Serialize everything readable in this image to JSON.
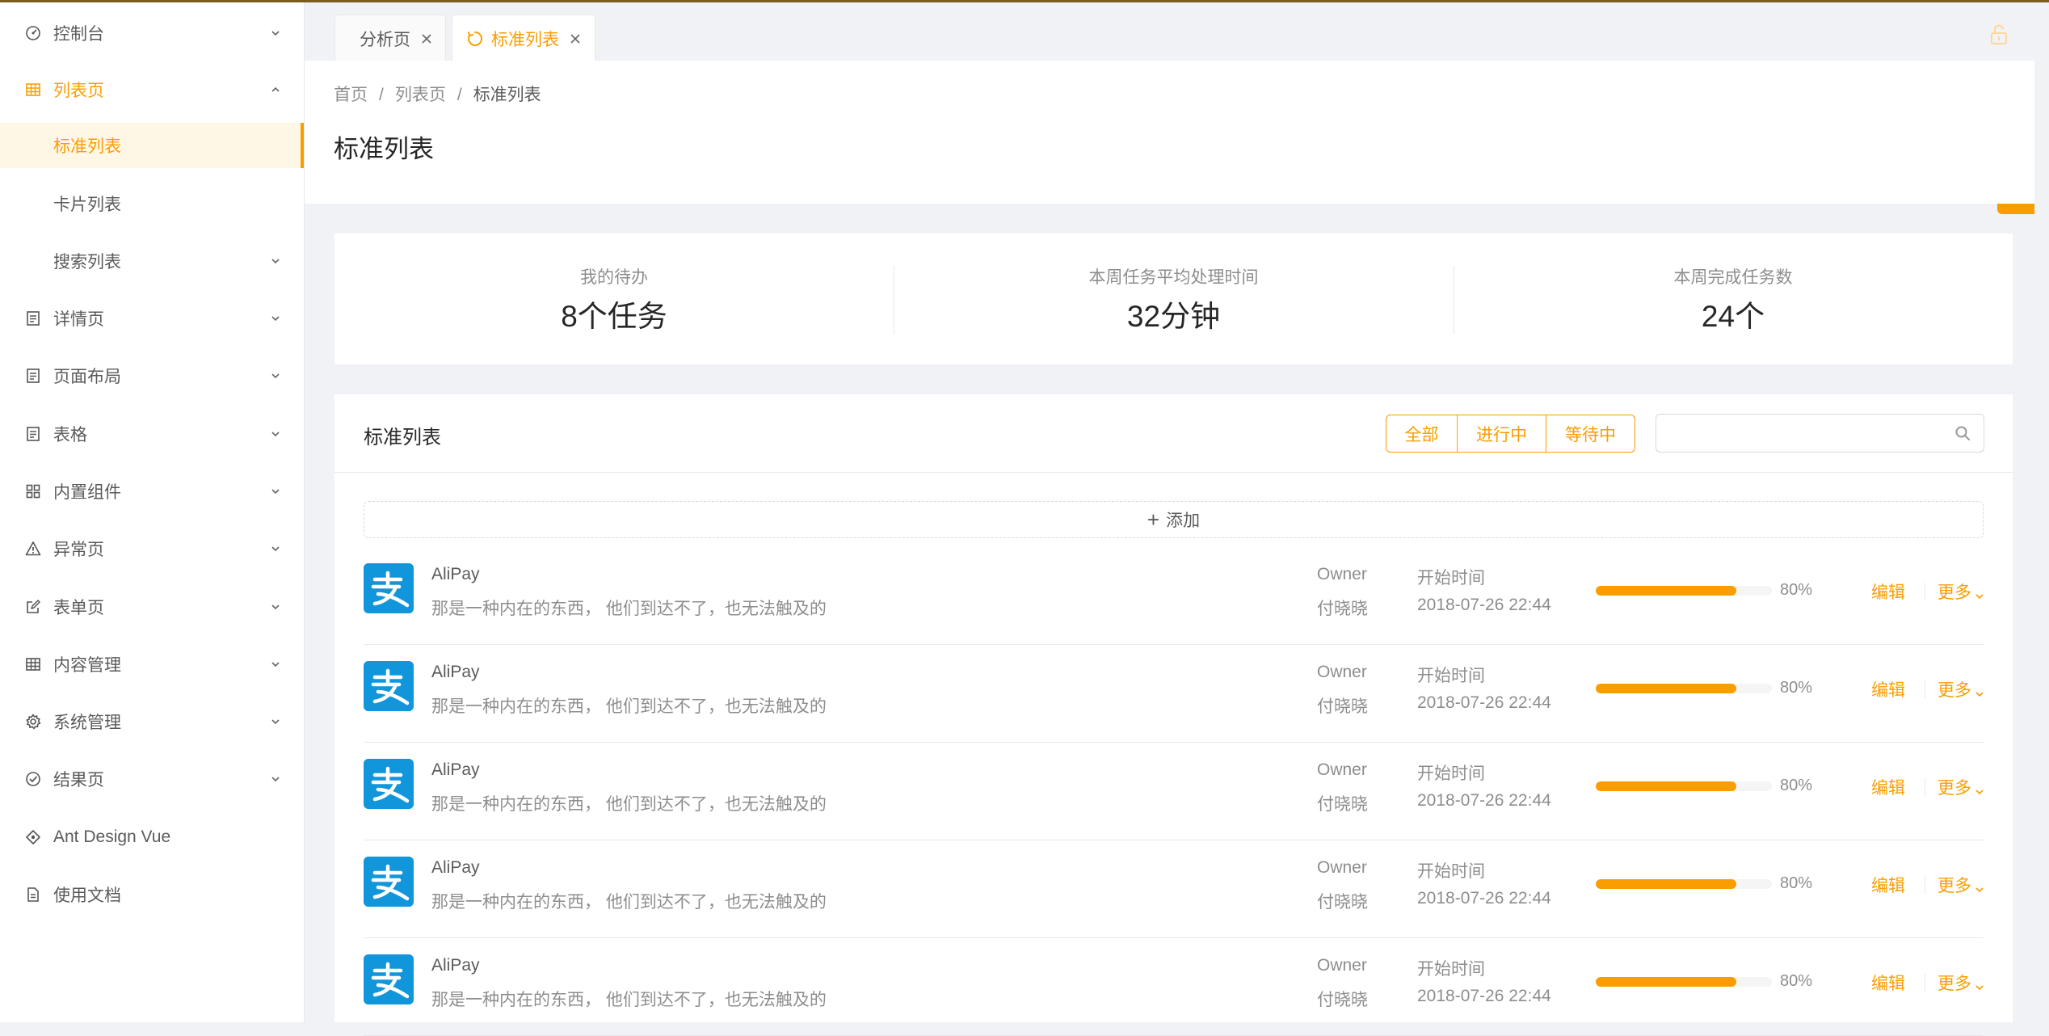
{
  "colors": {
    "accent": "#fa9d00",
    "alipay_blue": "#1296db"
  },
  "sidebar": {
    "items": [
      {
        "label": "控制台",
        "icon": "dashboard-icon",
        "arrow": "down"
      },
      {
        "label": "列表页",
        "icon": "table-icon",
        "arrow": "up",
        "open": true
      },
      {
        "label": "标准列表",
        "sub": true,
        "selected": true
      },
      {
        "label": "卡片列表",
        "sub": true
      },
      {
        "label": "搜索列表",
        "sub": true,
        "arrow": "down"
      },
      {
        "label": "详情页",
        "icon": "profile-icon",
        "arrow": "down"
      },
      {
        "label": "页面布局",
        "icon": "layout-icon",
        "arrow": "down"
      },
      {
        "label": "表格",
        "icon": "table-list-icon",
        "arrow": "down"
      },
      {
        "label": "内置组件",
        "icon": "appstore-icon",
        "arrow": "down"
      },
      {
        "label": "异常页",
        "icon": "warning-icon",
        "arrow": "down"
      },
      {
        "label": "表单页",
        "icon": "form-icon",
        "arrow": "down"
      },
      {
        "label": "内容管理",
        "icon": "table-icon",
        "arrow": "down"
      },
      {
        "label": "系统管理",
        "icon": "setting-icon",
        "arrow": "down"
      },
      {
        "label": "结果页",
        "icon": "check-circle-icon",
        "arrow": "down"
      },
      {
        "label": "Ant Design Vue",
        "icon": "ant-design-icon"
      },
      {
        "label": "使用文档",
        "icon": "file-icon"
      }
    ]
  },
  "tabs": [
    {
      "label": "分析页",
      "active": false
    },
    {
      "label": "标准列表",
      "active": true
    }
  ],
  "breadcrumb": {
    "home": "首页",
    "parent": "列表页",
    "current": "标准列表"
  },
  "page_title": "标准列表",
  "stats": [
    {
      "title": "我的待办",
      "value": "8个任务"
    },
    {
      "title": "本周任务平均处理时间",
      "value": "32分钟"
    },
    {
      "title": "本周完成任务数",
      "value": "24个"
    }
  ],
  "list": {
    "title": "标准列表",
    "filters": [
      "全部",
      "进行中",
      "等待中"
    ],
    "search_placeholder": "",
    "add_label": "添加",
    "edit_label": "编辑",
    "more_label": "更多",
    "items": [
      {
        "title": "AliPay",
        "description": "那是一种内在的东西， 他们到达不了，也无法触及的",
        "owner_label": "Owner",
        "owner": "付晓晓",
        "time_label": "开始时间",
        "time": "2018-07-26 22:44",
        "progress": 80,
        "progress_text": "80%"
      },
      {
        "title": "AliPay",
        "description": "那是一种内在的东西， 他们到达不了，也无法触及的",
        "owner_label": "Owner",
        "owner": "付晓晓",
        "time_label": "开始时间",
        "time": "2018-07-26 22:44",
        "progress": 80,
        "progress_text": "80%"
      },
      {
        "title": "AliPay",
        "description": "那是一种内在的东西， 他们到达不了，也无法触及的",
        "owner_label": "Owner",
        "owner": "付晓晓",
        "time_label": "开始时间",
        "time": "2018-07-26 22:44",
        "progress": 80,
        "progress_text": "80%"
      },
      {
        "title": "AliPay",
        "description": "那是一种内在的东西， 他们到达不了，也无法触及的",
        "owner_label": "Owner",
        "owner": "付晓晓",
        "time_label": "开始时间",
        "time": "2018-07-26 22:44",
        "progress": 80,
        "progress_text": "80%"
      },
      {
        "title": "AliPay",
        "description": "那是一种内在的东西， 他们到达不了，也无法触及的",
        "owner_label": "Owner",
        "owner": "付晓晓",
        "time_label": "开始时间",
        "time": "2018-07-26 22:44",
        "progress": 80,
        "progress_text": "80%"
      }
    ]
  }
}
